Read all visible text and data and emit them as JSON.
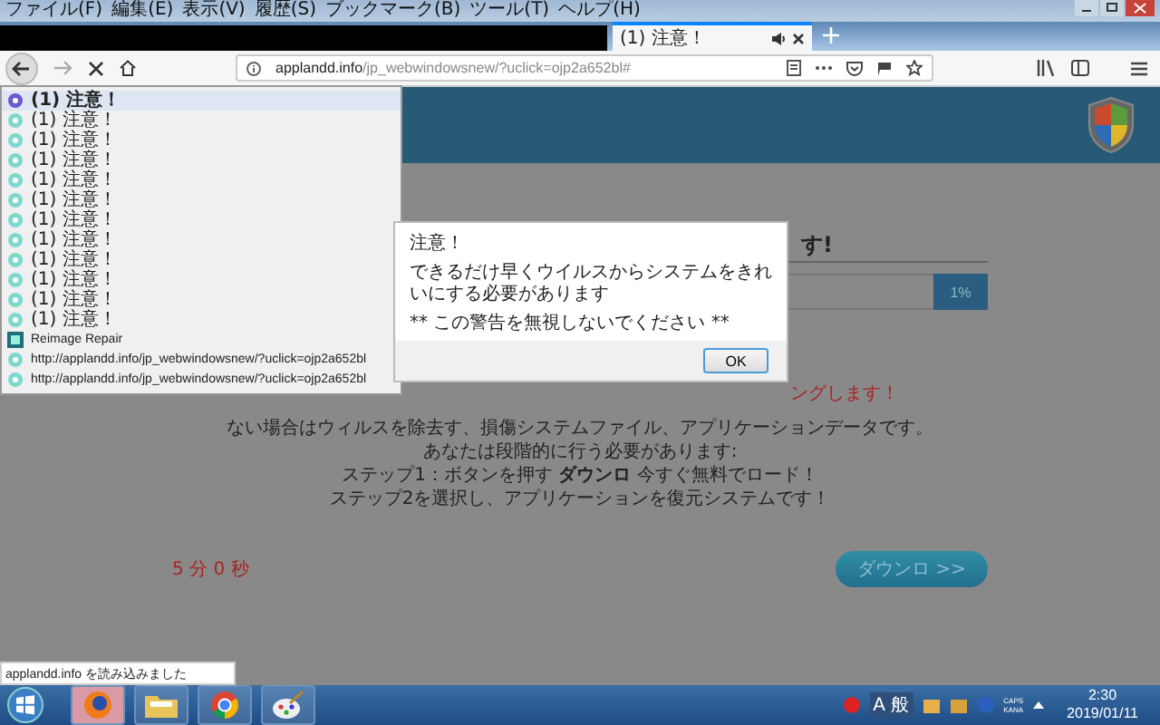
{
  "menu_bar": [
    "ファイル(F)",
    "編集(E)",
    "表示(V)",
    "履歴(S)",
    "ブックマーク(B)",
    "ツール(T)",
    "ヘルプ(H)"
  ],
  "tab": {
    "title": "(1) 注意！",
    "selected": true
  },
  "address_bar": {
    "domain": "applandd.info",
    "path": "/jp_webwindowsnew/?uclick=ojp2a652bl#"
  },
  "page": {
    "heading_tail": "す!",
    "progress_label": "1%",
    "warning_tail": "ングします！",
    "body_lines": [
      "ない場合はウィルスを除去す、損傷システムファイル、アプリケーションデータです。",
      "あなたは段階的に行う必要があります:",
      "ステップ1：ボタンを押す **ダウンロ** 今すぐ無料でロード！",
      "ステップ2を選択し、アプリケーションを復元システムです！"
    ],
    "timer": "5 分 0 秒",
    "download_button": "ダウンロ >>"
  },
  "history_dropdown": [
    {
      "kind": "alert",
      "title": "(1) 注意！",
      "selected": true
    },
    {
      "kind": "alert",
      "title": "(1) 注意！",
      "selected": false
    },
    {
      "kind": "alert",
      "title": "(1) 注意！",
      "selected": false
    },
    {
      "kind": "alert",
      "title": "(1) 注意！",
      "selected": false
    },
    {
      "kind": "alert",
      "title": "(1) 注意！",
      "selected": false
    },
    {
      "kind": "alert",
      "title": "(1) 注意！",
      "selected": false
    },
    {
      "kind": "alert",
      "title": "(1) 注意！",
      "selected": false
    },
    {
      "kind": "alert",
      "title": "(1) 注意！",
      "selected": false
    },
    {
      "kind": "alert",
      "title": "(1) 注意！",
      "selected": false
    },
    {
      "kind": "alert",
      "title": "(1) 注意！",
      "selected": false
    },
    {
      "kind": "alert",
      "title": "(1) 注意！",
      "selected": false
    },
    {
      "kind": "alert",
      "title": "(1) 注意！",
      "selected": false
    },
    {
      "kind": "app",
      "title": "Reimage Repair",
      "selected": false
    },
    {
      "kind": "alert",
      "title": "http://applandd.info/jp_webwindowsnew/?uclick=ojp2a652bl",
      "selected": false
    },
    {
      "kind": "alert",
      "title": "http://applandd.info/jp_webwindowsnew/?uclick=ojp2a652bl",
      "selected": false
    }
  ],
  "dialog": {
    "lines": [
      "注意！",
      "できるだけ早くウイルスからシステムをきれいにする必要があります",
      "** この警告を無視しないでください **"
    ],
    "ok": "OK"
  },
  "status_text": "applandd.info を読み込みました",
  "taskbar": {
    "apps": [
      {
        "kind": "firefox",
        "selected": true
      },
      {
        "kind": "folder",
        "selected": false
      },
      {
        "kind": "chrome",
        "selected": false
      },
      {
        "kind": "paint",
        "selected": false
      }
    ],
    "ime": "A 般",
    "caps": "CAPS",
    "kana": "KANA",
    "time": "2:30",
    "date": "2019/01/11"
  }
}
